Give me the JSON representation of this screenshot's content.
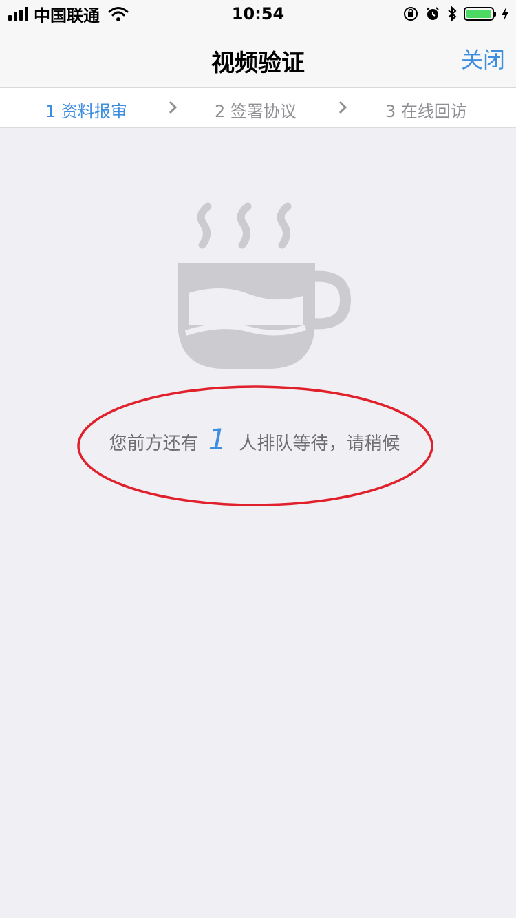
{
  "status_bar": {
    "carrier": "中国联通",
    "time": "10:54"
  },
  "nav": {
    "title": "视频验证",
    "close_label": "关闭"
  },
  "steps": [
    {
      "label": "1 资料报审",
      "active": true
    },
    {
      "label": "2 签署协议",
      "active": false
    },
    {
      "label": "3 在线回访",
      "active": false
    }
  ],
  "queue": {
    "prefix": "您前方还有",
    "count": "1",
    "suffix": "人排队等待，请稍候"
  },
  "colors": {
    "accent": "#3d8ee0",
    "background": "#efeff4",
    "icon_gray": "#cbcbd0",
    "annotation_red": "#e0202a",
    "battery_green": "#4cd964"
  },
  "icons": [
    "wifi-icon",
    "rotation-lock-icon",
    "alarm-icon",
    "bluetooth-icon",
    "battery-icon",
    "charging-icon",
    "chevron-right-icon",
    "coffee-cup-icon"
  ]
}
